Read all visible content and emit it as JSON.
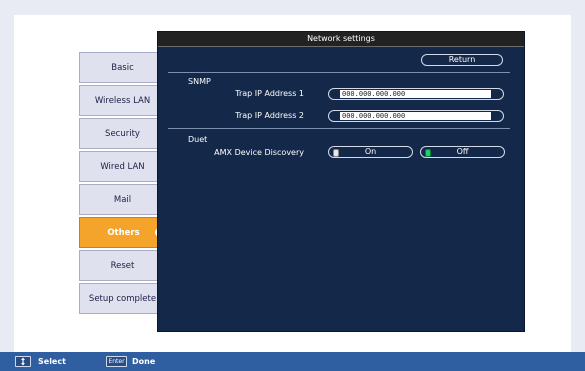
{
  "panel": {
    "title": "Network settings",
    "return_label": "Return"
  },
  "tabs": [
    {
      "label": "Basic",
      "active": false
    },
    {
      "label": "Wireless LAN",
      "active": false
    },
    {
      "label": "Security",
      "active": false
    },
    {
      "label": "Wired LAN",
      "active": false
    },
    {
      "label": "Mail",
      "active": false
    },
    {
      "label": "Others",
      "active": true
    },
    {
      "label": "Reset",
      "active": false
    },
    {
      "label": "Setup complete",
      "active": false
    }
  ],
  "snmp": {
    "section": "SNMP",
    "trap1_label": "Trap IP Address 1",
    "trap1_value": "000.000.000.000",
    "trap2_label": "Trap IP Address 2",
    "trap2_value": "000.000.000.000"
  },
  "duet": {
    "section": "Duet",
    "amx_label": "AMX Device Discovery",
    "on_label": "On",
    "off_label": "Off",
    "selected": "Off"
  },
  "bottom": {
    "select_key_icon": "up-down-arrow-icon",
    "select_label": "Select",
    "enter_key": "Enter",
    "done_label": "Done"
  },
  "colors": {
    "panel": "#14284a",
    "active_tab": "#f4a42a",
    "bottom_bar": "#2f5fa0"
  }
}
